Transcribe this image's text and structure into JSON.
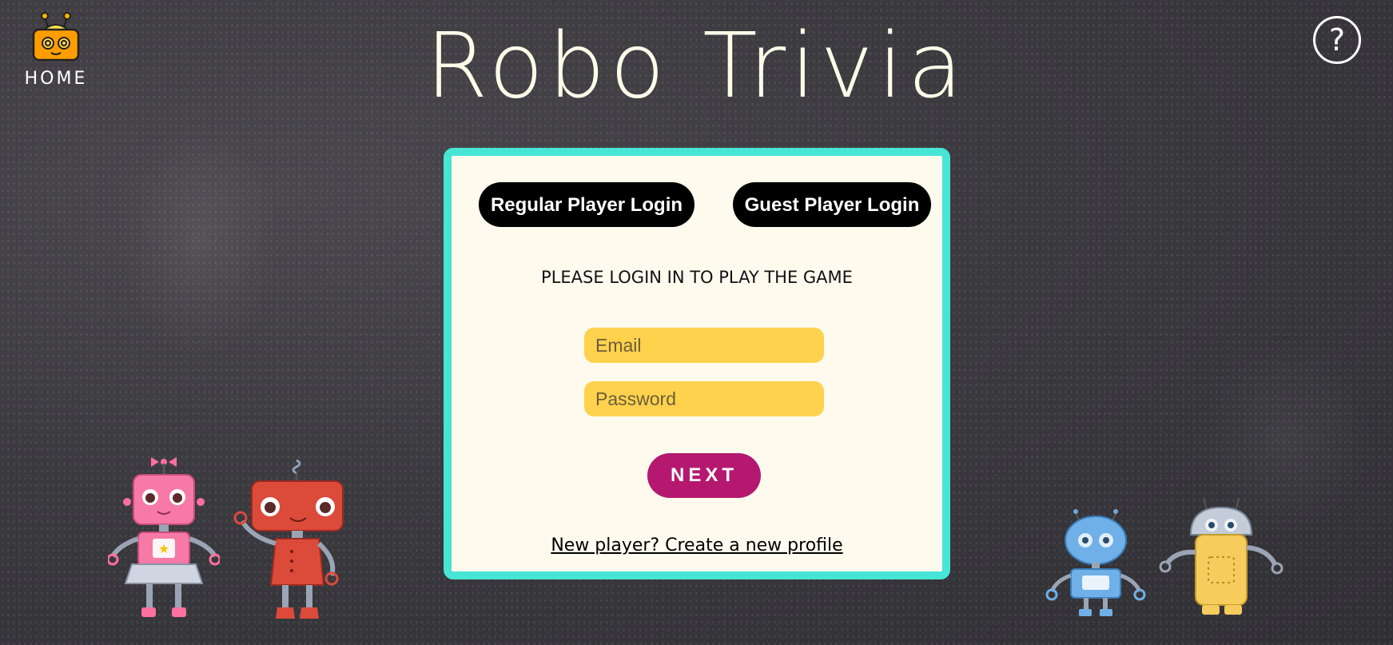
{
  "app": {
    "title": "Robo Trivia"
  },
  "nav": {
    "home_label": "HOME",
    "home_icon": "robot-head-icon",
    "help_icon": "question-circle-icon",
    "help_glyph": "?"
  },
  "login": {
    "tab_regular": "Regular Player Login",
    "tab_guest": "Guest Player Login",
    "prompt": "PLEASE LOGIN IN TO PLAY THE GAME",
    "email_placeholder": "Email",
    "email_value": "",
    "password_placeholder": "Password",
    "password_value": "",
    "next_label": "NEXT",
    "create_link": "New player? Create a new profile"
  },
  "colors": {
    "background": "#3b3a3f",
    "card_border": "#47e5d5",
    "card_bg": "#fffaee",
    "input_bg": "#ffd24d",
    "next_button": "#b4196f",
    "tab_button": "#000000"
  }
}
